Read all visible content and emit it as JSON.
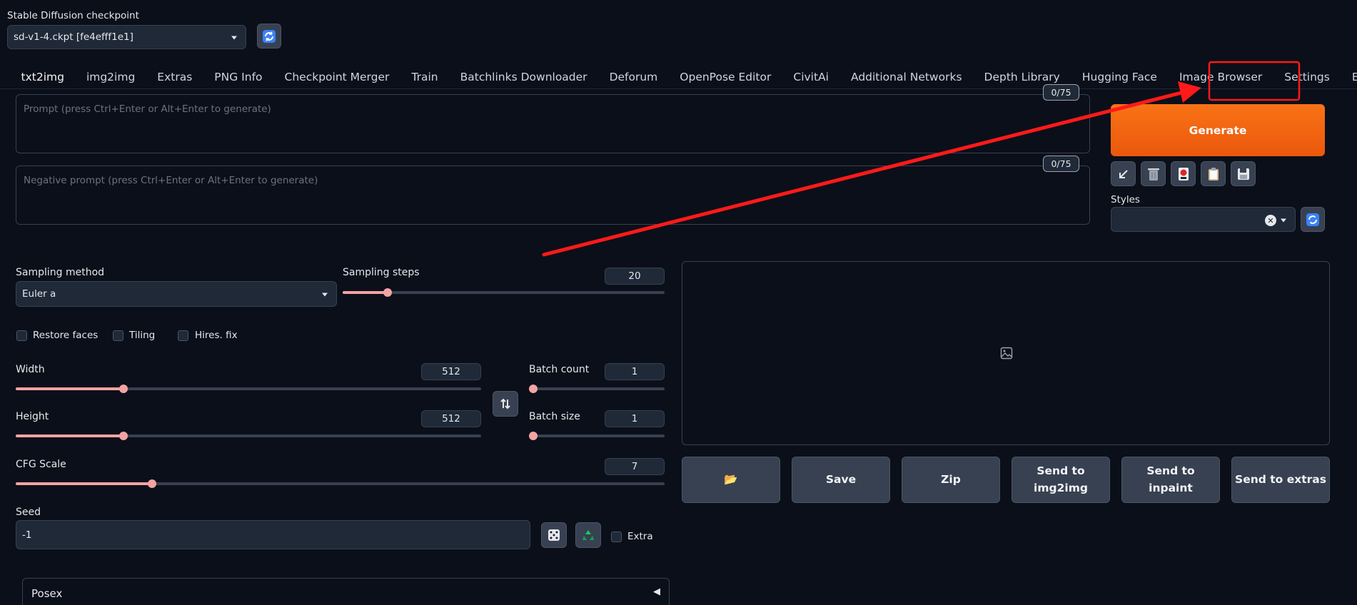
{
  "checkpoint": {
    "label": "Stable Diffusion checkpoint",
    "value": "sd-v1-4.ckpt [fe4efff1e1]"
  },
  "tabs": [
    {
      "label": "txt2img",
      "active": true
    },
    {
      "label": "img2img"
    },
    {
      "label": "Extras"
    },
    {
      "label": "PNG Info"
    },
    {
      "label": "Checkpoint Merger"
    },
    {
      "label": "Train"
    },
    {
      "label": "Batchlinks Downloader"
    },
    {
      "label": "Deforum"
    },
    {
      "label": "OpenPose Editor"
    },
    {
      "label": "CivitAi"
    },
    {
      "label": "Additional Networks"
    },
    {
      "label": "Depth Library"
    },
    {
      "label": "Hugging Face"
    },
    {
      "label": "Image Browser"
    },
    {
      "label": "Settings"
    },
    {
      "label": "Extensions",
      "highlighted": true
    }
  ],
  "prompt": {
    "placeholder": "Prompt (press Ctrl+Enter or Alt+Enter to generate)",
    "counter": "0/75"
  },
  "negative_prompt": {
    "placeholder": "Negative prompt (press Ctrl+Enter or Alt+Enter to generate)",
    "counter": "0/75"
  },
  "generate": {
    "label": "Generate"
  },
  "tool_icons": [
    "arrow-down-left-icon",
    "trash-icon",
    "red-seal-icon",
    "clipboard-icon",
    "floppy-disk-icon"
  ],
  "styles": {
    "label": "Styles",
    "value": "",
    "clear_symbol": "✕"
  },
  "sampling": {
    "method_label": "Sampling method",
    "method_value": "Euler a",
    "steps_label": "Sampling steps",
    "steps_value": "20"
  },
  "checkboxes": {
    "restore_faces": "Restore faces",
    "tiling": "Tiling",
    "hires_fix": "Hires. fix"
  },
  "size": {
    "width_label": "Width",
    "width_value": "512",
    "height_label": "Height",
    "height_value": "512",
    "batch_count_label": "Batch count",
    "batch_count_value": "1",
    "batch_size_label": "Batch size",
    "batch_size_value": "1"
  },
  "cfg": {
    "label": "CFG Scale",
    "value": "7"
  },
  "seed": {
    "label": "Seed",
    "value": "-1",
    "extra_label": "Extra"
  },
  "output_buttons": {
    "folder": "📂",
    "save": "Save",
    "zip": "Zip",
    "send_img2img": "Send to img2img",
    "send_inpaint": "Send to inpaint",
    "send_extras": "Send to extras"
  },
  "posex": {
    "label": "Posex",
    "toggle_symbol": "◀"
  },
  "colors": {
    "background": "#0b0f19",
    "generate": "#f97316",
    "slider_accent": "#f4a3a3",
    "annotation_red": "#ff1a1a"
  }
}
